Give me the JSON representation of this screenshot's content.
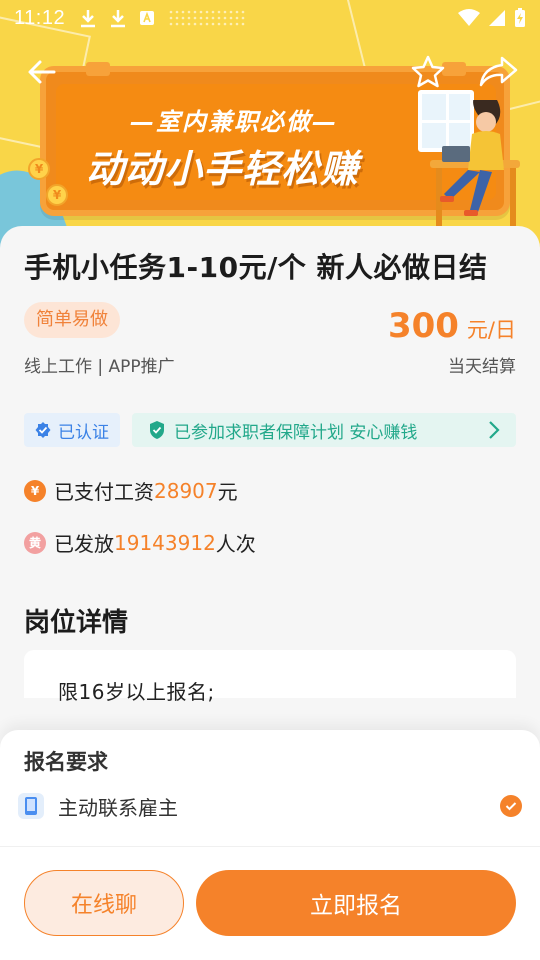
{
  "status_bar": {
    "time": "11:12",
    "left_icons": [
      "download-icon",
      "download-icon",
      "a-box-icon",
      "dots-icon"
    ],
    "right_icons": [
      "wifi-icon",
      "signal-icon",
      "battery-charging-icon"
    ]
  },
  "nav": {
    "back_icon": "arrow-left-icon",
    "favorite_icon": "star-icon",
    "share_icon": "share-icon"
  },
  "banner": {
    "subtitle": "—室内兼职必做—",
    "headline": "动动小手轻松赚",
    "coin_symbol": "¥"
  },
  "job": {
    "title": "手机小任务1-10元/个 新人必做日结",
    "tag": "简单易做",
    "meta": "线上工作 | APP推广",
    "salary_amount": "300",
    "salary_unit": "元/日",
    "settlement": "当天结算"
  },
  "badges": {
    "certified": "已认证",
    "guarantee": "已参加求职者保障计划 安心赚钱"
  },
  "stats": {
    "paid_prefix": "已支付工资",
    "paid_amount": "28907",
    "paid_suffix": "元",
    "issued_prefix": "已发放",
    "issued_count": "19143912",
    "issued_suffix": "人次",
    "issued_icon_char": "黄"
  },
  "details": {
    "section_title": "岗位详情",
    "first_line": "限16岁以上报名;"
  },
  "requirements": {
    "title": "报名要求",
    "items": [
      {
        "label": "主动联系雇主",
        "checked": true
      }
    ]
  },
  "actions": {
    "chat_label": "在线聊",
    "apply_label": "立即报名"
  },
  "colors": {
    "accent": "#f5822a",
    "banner_bg": "#f9d648",
    "board": "#f08a1c",
    "certified_blue": "#3b82e6",
    "guarantee_green": "#22a88a"
  }
}
